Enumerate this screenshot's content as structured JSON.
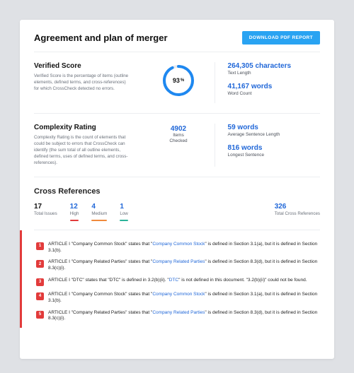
{
  "header": {
    "title": "Agreement and plan of merger",
    "download_button": "DOWNLOAD PDF REPORT"
  },
  "verified_score": {
    "title": "Verified Score",
    "description": "Verified Score is the percentage of items (outline elements, defined terms, and cross-references) for which CrossCheck detected no errors.",
    "percent": "93",
    "percent_suffix": "%"
  },
  "complexity": {
    "title": "Complexity Rating",
    "description": "Complexity Rating is the count of elements that could be subject to errors that CrossCheck can identify (the sum total of all outline elements, defined terms, uses of defined terms, and cross-references).",
    "items_value": "4902",
    "items_label_1": "Items",
    "items_label_2": "Checked"
  },
  "stats": {
    "text_length_value": "264,305 characters",
    "text_length_label": "Text Length",
    "word_count_value": "41,167 words",
    "word_count_label": "Word Count",
    "avg_sentence_value": "59 words",
    "avg_sentence_label": "Average Sentence Length",
    "longest_sentence_value": "816 words",
    "longest_sentence_label": "Longest Sentence"
  },
  "cross_refs": {
    "section_title": "Cross References",
    "total_issues_value": "17",
    "total_issues_label": "Total Issues",
    "high_value": "12",
    "high_label": "High",
    "medium_value": "4",
    "medium_label": "Medium",
    "low_value": "1",
    "low_label": "Low",
    "total_refs_value": "326",
    "total_refs_label": "Total Cross References"
  },
  "issues": [
    {
      "num": "1",
      "pre": "ARTICLE I \"Company Common Stock\" states that \"",
      "link": "Company Common Stock",
      "post": "\" is defined in Section 3.1(a), but it is defined in Section 3.1(b)."
    },
    {
      "num": "2",
      "pre": "ARTICLE I \"Company Related Parties\" states that \"",
      "link": "Company Related Parties",
      "post": "\" is defined in Section 8.3(d), but it is defined in Section 8.3(c)(i)."
    },
    {
      "num": "3",
      "pre": "ARTICLE I \"DTC\" states that \"DTC\" is defined in 3.2(b)(ii). \"",
      "link": "DTC",
      "post": "\" is not defined in this document. \"3.2(b)(ii)\" could not be found."
    },
    {
      "num": "4",
      "pre": "ARTICLE I \"Company Common Stock\" states that \"",
      "link": "Company Common Stock",
      "post": "\" is defined in Section 3.1(a), but it is defined in Section 3.1(b)."
    },
    {
      "num": "5",
      "pre": "ARTICLE I \"Company Related Parties\" states that \"",
      "link": "Company Related Parties",
      "post": "\" is defined in Section 8.3(d), but it is defined in Section 8.3(c)(i)."
    }
  ]
}
